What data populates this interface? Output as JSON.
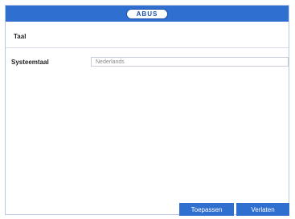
{
  "titlebar": {
    "logo_text": "ABUS"
  },
  "section": {
    "title": "Taal"
  },
  "settings": {
    "system_language_label": "Systeemtaal",
    "system_language_value": "Nederlands"
  },
  "buttons": {
    "apply_label": "Toepassen",
    "exit_label": "Verlaten"
  },
  "colors": {
    "titlebar": "#2f6fd0",
    "button": "#2f6fd0",
    "logo_border": "#1a4fa8"
  }
}
